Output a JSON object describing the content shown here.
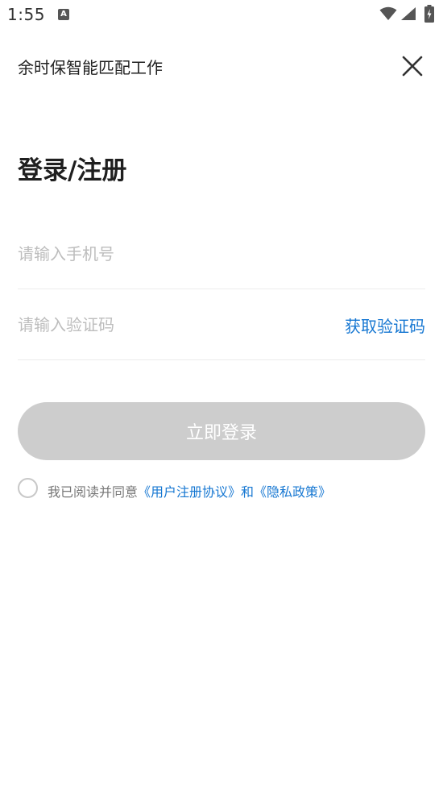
{
  "status_bar": {
    "time": "1:55",
    "notification_icon": "a-icon",
    "wifi_icon": "wifi-icon",
    "signal_icon": "signal-icon",
    "battery_icon": "battery-charging-icon"
  },
  "header": {
    "title": "余时保智能匹配工作",
    "close_icon": "close-icon"
  },
  "page_title": "登录/注册",
  "phone": {
    "placeholder": "请输入手机号",
    "value": ""
  },
  "code": {
    "placeholder": "请输入验证码",
    "value": "",
    "get_code_label": "获取验证码"
  },
  "login_button": {
    "label": "立即登录"
  },
  "agreement": {
    "prefix": "我已阅读并同意",
    "user_agreement_link": "《用户注册协议》",
    "conjunction": "和",
    "privacy_link": "《隐私政策》",
    "checked": false
  },
  "colors": {
    "accent": "#1677d2",
    "button_disabled": "#cdcdcd",
    "placeholder": "#bdbdbd",
    "divider": "#ececec"
  }
}
